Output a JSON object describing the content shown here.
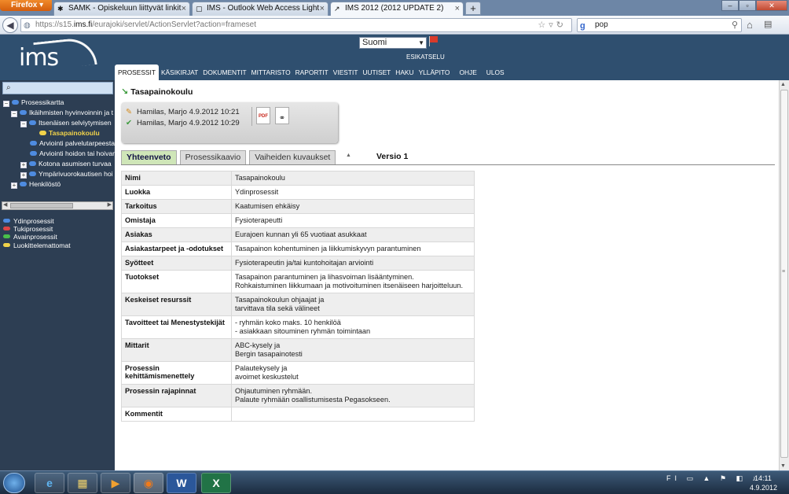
{
  "browser": {
    "app_button": "Firefox",
    "tabs": [
      {
        "title": "SAMK - Opiskeluun liittyvät linkit",
        "close": "×"
      },
      {
        "title": "IMS - Outlook Web Access Light",
        "close": "×"
      },
      {
        "title": "IMS 2012 (2012 UPDATE 2)",
        "close": "×"
      }
    ],
    "new_tab": "+",
    "window_controls": {
      "minimize": "–",
      "maximize": "▫",
      "close": "✕"
    },
    "url_prefix": "https://s15.",
    "url_host": "ims.fi",
    "url_path": "/eurajoki/servlet/ActionServlet?action=frameset",
    "search_value": "pop",
    "search_engine_glyph": "g"
  },
  "header": {
    "logo": "ims",
    "language": "Suomi",
    "preview": "ESIKATSELU",
    "nav": [
      "PROSESSIT",
      "KÄSIKIRJAT",
      "DOKUMENTIT",
      "MITTARISTO",
      "RAPORTIT",
      "VIESTIT",
      "UUTISET",
      "HAKU",
      "YLLÄPITO",
      "OHJE",
      "ULOS"
    ]
  },
  "sidebar": {
    "tree": [
      {
        "label": "Prosessikartta",
        "expander": "−"
      },
      {
        "label": "Ikäihmisten hyvinvoinnin ja t",
        "expander": "−"
      },
      {
        "label": "Itsenäisen selviytymisen",
        "expander": "−"
      },
      {
        "label": "Tasapainokoulu"
      },
      {
        "label": "Arviointi palvelutarpeesta"
      },
      {
        "label": "Arviointi hoidon tai hoivan"
      },
      {
        "label": "Kotona asumisen turvaa",
        "expander": "+"
      },
      {
        "label": "Ympärivuorokautisen hoi",
        "expander": "+"
      },
      {
        "label": "Henkilöstö",
        "expander": "+"
      }
    ],
    "legend": [
      {
        "label": "Ydinprosessit",
        "color": "#4e8be0"
      },
      {
        "label": "Tukiprosessit",
        "color": "#e04646"
      },
      {
        "label": "Avainprosessit",
        "color": "#49c04a"
      },
      {
        "label": "Luokittelemattomat",
        "color": "#f0d24a"
      }
    ]
  },
  "document": {
    "title": "Tasapainokoulu",
    "info": [
      {
        "text": "Hamilas, Marjo 4.9.2012 10:21",
        "icon": "pencil-icon"
      },
      {
        "text": "Hamilas, Marjo 4.9.2012 10:29",
        "icon": "checkmark-icon"
      }
    ],
    "pdf_label": "PDF",
    "tabs": [
      "Yhteenveto",
      "Prosessikaavio",
      "Vaiheiden kuvaukset"
    ],
    "version": "Versio 1",
    "properties": [
      {
        "key": "Nimi",
        "value": [
          "Tasapainokoulu"
        ]
      },
      {
        "key": "Luokka",
        "value": [
          "Ydinprosessit"
        ]
      },
      {
        "key": "Tarkoitus",
        "value": [
          "Kaatumisen ehkäisy"
        ]
      },
      {
        "key": "Omistaja",
        "value": [
          "Fysioterapeutti"
        ]
      },
      {
        "key": "Asiakas",
        "value": [
          "Eurajoen kunnan yli 65 vuotiaat asukkaat"
        ]
      },
      {
        "key": "Asiakastarpeet ja -odotukset",
        "value": [
          "Tasapainon kohentuminen ja liikkumiskyvyn parantuminen"
        ]
      },
      {
        "key": "Syötteet",
        "value": [
          "Fysioterapeutin ja/tai kuntohoitajan arviointi"
        ]
      },
      {
        "key": "Tuotokset",
        "value": [
          "Tasapainon parantuminen ja lihasvoiman lisääntyminen.",
          "Rohkaistuminen liikkumaan ja motivoituminen itsenäiseen harjoitteluun."
        ]
      },
      {
        "key": "Keskeiset resurssit",
        "value": [
          "Tasapainokoulun ohjaajat ja",
          "tarvittava tila sekä välineet"
        ]
      },
      {
        "key": "Tavoitteet tai Menestystekijät",
        "value": [
          "- ryhmän koko maks. 10 henkilöä",
          "- asiakkaan sitouminen ryhmän toimintaan"
        ]
      },
      {
        "key": "Mittarit",
        "value": [
          "ABC-kysely ja",
          "Bergin tasapainotesti"
        ]
      },
      {
        "key": "Prosessin kehittämismenettely",
        "value": [
          "Palautekysely ja",
          "avoimet keskustelut"
        ]
      },
      {
        "key": "Prosessin rajapinnat",
        "value": [
          "Ohjautuminen ryhmään.",
          "Palaute ryhmään osallistumisesta Pegasokseen."
        ]
      },
      {
        "key": "Kommentit",
        "value": [
          ""
        ]
      }
    ]
  },
  "taskbar": {
    "apps": [
      "e",
      "▦",
      "▶",
      "◉",
      "W",
      "X"
    ],
    "tray": "FI",
    "time": "14:11",
    "date": "4.9.2012"
  }
}
